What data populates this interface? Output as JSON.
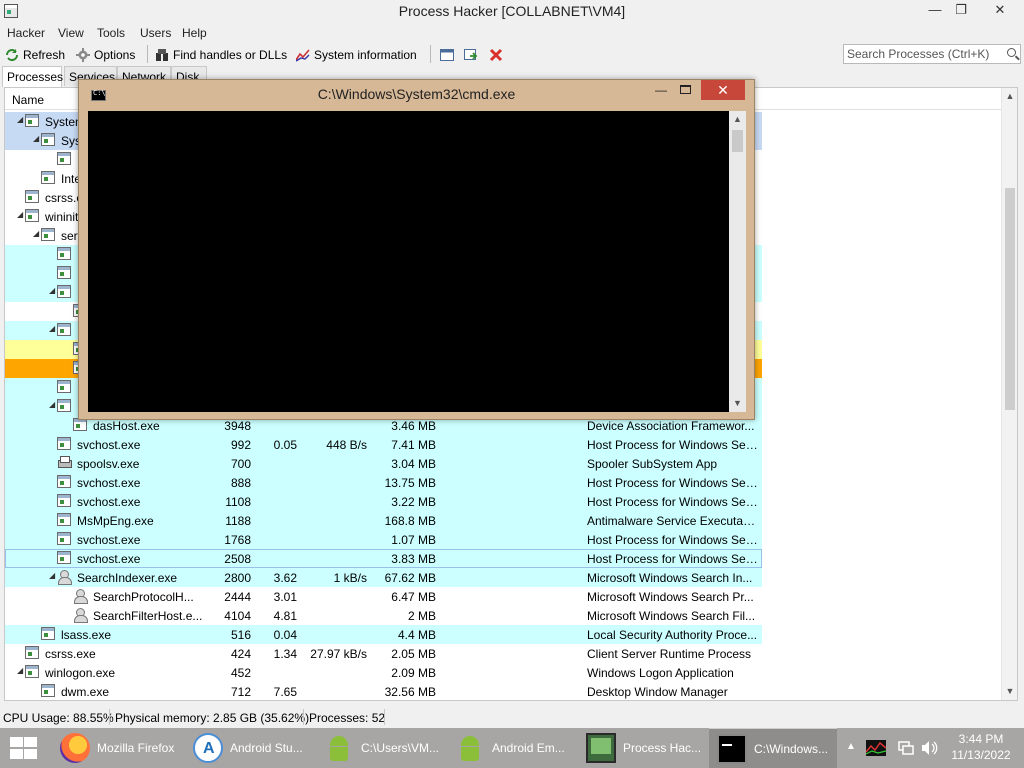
{
  "window": {
    "title": "Process Hacker [COLLABNET\\VM4]",
    "minimize": "—",
    "restore": "❐",
    "close": "✕"
  },
  "menu": [
    "Hacker",
    "View",
    "Tools",
    "Users",
    "Help"
  ],
  "toolbar": {
    "refresh": "Refresh",
    "options": "Options",
    "find_handles": "Find handles or DLLs",
    "system_information": "System information",
    "search_placeholder": "Search Processes (Ctrl+K)"
  },
  "tabs": [
    "Processes",
    "Services",
    "Network",
    "Disk"
  ],
  "columns": {
    "name": "Name"
  },
  "processes": [
    {
      "name": "System",
      "pid": "",
      "cpu": "",
      "io": "",
      "mem": "",
      "desc": "",
      "bg": "blue",
      "indent": 1,
      "expander": "◢",
      "icon": "app"
    },
    {
      "name": "System",
      "pid": "",
      "cpu": "",
      "io": "",
      "mem": "",
      "desc": "",
      "bg": "blue",
      "indent": 2,
      "expander": "◢",
      "icon": "app"
    },
    {
      "name": "",
      "pid": "",
      "cpu": "",
      "io": "",
      "mem": "",
      "desc": "",
      "bg": "none",
      "indent": 3,
      "expander": "",
      "icon": "app"
    },
    {
      "name": "Interrupts",
      "pid": "",
      "cpu": "",
      "io": "",
      "mem": "",
      "desc": "",
      "bg": "none",
      "indent": 2,
      "expander": "",
      "icon": "app"
    },
    {
      "name": "csrss.exe",
      "pid": "",
      "cpu": "",
      "io": "",
      "mem": "",
      "desc": "",
      "bg": "none",
      "indent": 1,
      "expander": "",
      "icon": "app"
    },
    {
      "name": "wininit.exe",
      "pid": "",
      "cpu": "",
      "io": "",
      "mem": "",
      "desc": "",
      "bg": "none",
      "indent": 1,
      "expander": "◢",
      "icon": "app"
    },
    {
      "name": "services.exe",
      "pid": "",
      "cpu": "",
      "io": "",
      "mem": "",
      "desc": "",
      "bg": "none",
      "indent": 2,
      "expander": "◢",
      "icon": "app"
    },
    {
      "name": "",
      "pid": "",
      "cpu": "",
      "io": "",
      "mem": "",
      "desc": "",
      "bg": "cyan",
      "indent": 3,
      "expander": "",
      "icon": "app"
    },
    {
      "name": "",
      "pid": "",
      "cpu": "",
      "io": "",
      "mem": "",
      "desc": "",
      "bg": "cyan",
      "indent": 3,
      "expander": "",
      "icon": "app"
    },
    {
      "name": "",
      "pid": "",
      "cpu": "",
      "io": "",
      "mem": "",
      "desc": "",
      "bg": "cyan",
      "indent": 3,
      "expander": "◢",
      "icon": "app"
    },
    {
      "name": "",
      "pid": "",
      "cpu": "",
      "io": "",
      "mem": "",
      "desc": "",
      "bg": "none",
      "indent": 4,
      "expander": "",
      "icon": "app"
    },
    {
      "name": "",
      "pid": "",
      "cpu": "",
      "io": "",
      "mem": "",
      "desc": "",
      "bg": "cyan",
      "indent": 3,
      "expander": "◢",
      "icon": "app"
    },
    {
      "name": "",
      "pid": "",
      "cpu": "",
      "io": "",
      "mem": "",
      "desc": "",
      "bg": "yellow",
      "indent": 4,
      "expander": "",
      "icon": "app"
    },
    {
      "name": "",
      "pid": "",
      "cpu": "",
      "io": "",
      "mem": "",
      "desc": "",
      "bg": "orange",
      "indent": 4,
      "expander": "",
      "icon": "app"
    },
    {
      "name": "",
      "pid": "",
      "cpu": "",
      "io": "",
      "mem": "",
      "desc": "",
      "bg": "cyan",
      "indent": 3,
      "expander": "",
      "icon": "app"
    },
    {
      "name": "",
      "pid": "",
      "cpu": "",
      "io": "",
      "mem": "",
      "desc": "",
      "bg": "cyan",
      "indent": 3,
      "expander": "◢",
      "icon": "app"
    },
    {
      "name": "dasHost.exe",
      "pid": "3948",
      "cpu": "",
      "io": "",
      "mem": "3.46 MB",
      "desc": "Device Association Framewor...",
      "bg": "cyan",
      "indent": 4,
      "expander": "",
      "icon": "app"
    },
    {
      "name": "svchost.exe",
      "pid": "992",
      "cpu": "0.05",
      "io": "448 B/s",
      "mem": "7.41 MB",
      "desc": "Host Process for Windows Ser...",
      "bg": "cyan",
      "indent": 3,
      "expander": "",
      "icon": "app"
    },
    {
      "name": "spoolsv.exe",
      "pid": "700",
      "cpu": "",
      "io": "",
      "mem": "3.04 MB",
      "desc": "Spooler SubSystem App",
      "bg": "cyan",
      "indent": 3,
      "expander": "",
      "icon": "printer"
    },
    {
      "name": "svchost.exe",
      "pid": "888",
      "cpu": "",
      "io": "",
      "mem": "13.75 MB",
      "desc": "Host Process for Windows Ser...",
      "bg": "cyan",
      "indent": 3,
      "expander": "",
      "icon": "app"
    },
    {
      "name": "svchost.exe",
      "pid": "1108",
      "cpu": "",
      "io": "",
      "mem": "3.22 MB",
      "desc": "Host Process for Windows Ser...",
      "bg": "cyan",
      "indent": 3,
      "expander": "",
      "icon": "app"
    },
    {
      "name": "MsMpEng.exe",
      "pid": "1188",
      "cpu": "",
      "io": "",
      "mem": "168.8 MB",
      "desc": "Antimalware Service Executable",
      "bg": "cyan",
      "indent": 3,
      "expander": "",
      "icon": "app"
    },
    {
      "name": "svchost.exe",
      "pid": "1768",
      "cpu": "",
      "io": "",
      "mem": "1.07 MB",
      "desc": "Host Process for Windows Ser...",
      "bg": "cyan",
      "indent": 3,
      "expander": "",
      "icon": "app"
    },
    {
      "name": "svchost.exe",
      "pid": "2508",
      "cpu": "",
      "io": "",
      "mem": "3.83 MB",
      "desc": "Host Process for Windows Ser...",
      "bg": "cyan",
      "indent": 3,
      "expander": "",
      "icon": "app",
      "selected": true
    },
    {
      "name": "SearchIndexer.exe",
      "pid": "2800",
      "cpu": "3.62",
      "io": "1 kB/s",
      "mem": "67.62 MB",
      "desc": "Microsoft Windows Search In...",
      "bg": "cyan",
      "indent": 3,
      "expander": "◢",
      "icon": "user"
    },
    {
      "name": "SearchProtocolH...",
      "pid": "2444",
      "cpu": "3.01",
      "io": "",
      "mem": "6.47 MB",
      "desc": "Microsoft Windows Search Pr...",
      "bg": "none",
      "indent": 4,
      "expander": "",
      "icon": "user"
    },
    {
      "name": "SearchFilterHost.e...",
      "pid": "4104",
      "cpu": "4.81",
      "io": "",
      "mem": "2 MB",
      "desc": "Microsoft Windows Search Fil...",
      "bg": "none",
      "indent": 4,
      "expander": "",
      "icon": "user"
    },
    {
      "name": "lsass.exe",
      "pid": "516",
      "cpu": "0.04",
      "io": "",
      "mem": "4.4 MB",
      "desc": "Local Security Authority Proce...",
      "bg": "cyan",
      "indent": 2,
      "expander": "",
      "icon": "app"
    },
    {
      "name": "csrss.exe",
      "pid": "424",
      "cpu": "1.34",
      "io": "27.97 kB/s",
      "mem": "2.05 MB",
      "desc": "Client Server Runtime Process",
      "bg": "none",
      "indent": 1,
      "expander": "",
      "icon": "app"
    },
    {
      "name": "winlogon.exe",
      "pid": "452",
      "cpu": "",
      "io": "",
      "mem": "2.09 MB",
      "desc": "Windows Logon Application",
      "bg": "none",
      "indent": 1,
      "expander": "◢",
      "icon": "app"
    },
    {
      "name": "dwm.exe",
      "pid": "712",
      "cpu": "7.65",
      "io": "",
      "mem": "32.56 MB",
      "desc": "Desktop Window Manager",
      "bg": "none",
      "indent": 2,
      "expander": "",
      "icon": "app"
    }
  ],
  "statusbar": {
    "cpu": "CPU Usage: 88.55%",
    "memory": "Physical memory: 2.85 GB (35.62%)",
    "processes": "Processes: 52"
  },
  "cmd_window": {
    "title": "C:\\Windows\\System32\\cmd.exe",
    "minimize": "—",
    "close": "✕"
  },
  "taskbar": {
    "items": [
      {
        "label": "Mozilla Firefox",
        "icon": "firefox-icon"
      },
      {
        "label": "Android Stu...",
        "icon": "android-studio-icon"
      },
      {
        "label": "C:\\Users\\VM...",
        "icon": "android-icon"
      },
      {
        "label": "Android Em...",
        "icon": "android-icon"
      },
      {
        "label": "Process Hac...",
        "icon": "process-hacker-icon"
      },
      {
        "label": "C:\\Windows...",
        "icon": "cmd-icon"
      }
    ],
    "clock_time": "3:44 PM",
    "clock_date": "11/13/2022"
  }
}
